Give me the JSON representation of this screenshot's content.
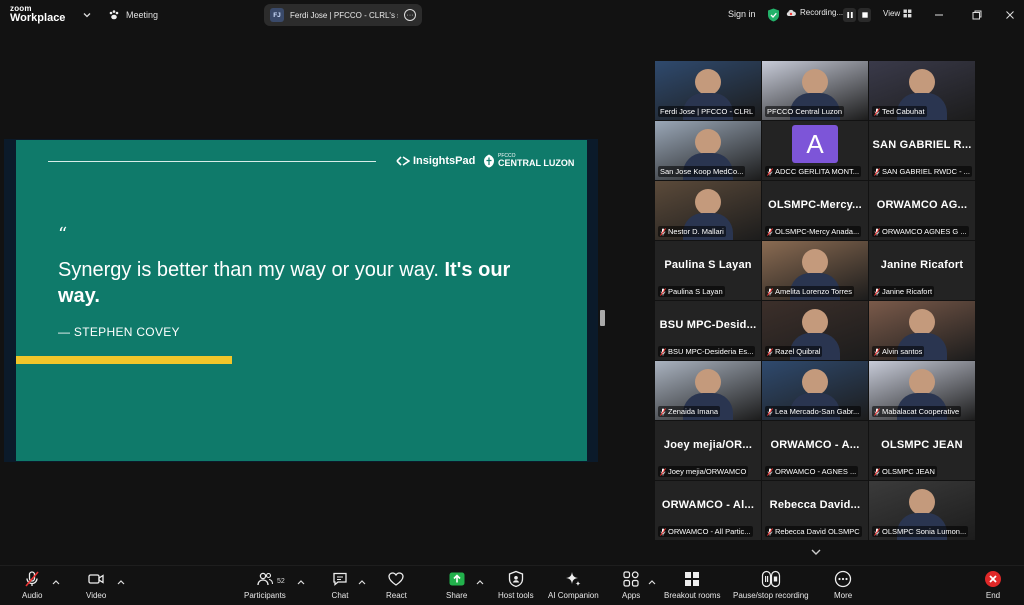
{
  "app": {
    "logo_top": "zoom",
    "logo_bottom": "Workplace"
  },
  "topbar": {
    "meeting_label": "Meeting",
    "share_initials": "FJ",
    "share_title": "Ferdi Jose | PFCCO - CLRL's scree",
    "sign_in": "Sign in",
    "recording_label": "Recording...",
    "view_label": "View"
  },
  "slide": {
    "brand_insights": "InsightsPad",
    "brand_pfcco_small": "PFCCO",
    "brand_pfcco_big": "CENTRAL LUZON",
    "quote_mark": "“",
    "quote_line1": "Synergy is better than my way or your way.",
    "quote_bold": "It's our way.",
    "author": "— STEPHEN COVEY",
    "colors": {
      "background": "#0f7a6a",
      "accent_bar": "#f2c62a"
    }
  },
  "gallery": {
    "tiles": [
      {
        "caption": "Ferdi Jose | PFCCO - CLRL",
        "muted": false,
        "kind": "video",
        "active": true
      },
      {
        "caption": "PFCCO Central Luzon",
        "muted": false,
        "kind": "video"
      },
      {
        "caption": "Ted Cabuhat",
        "muted": true,
        "kind": "video"
      },
      {
        "caption": "San Jose Koop MedCo...",
        "muted": false,
        "kind": "video"
      },
      {
        "caption": "ADCC GERLITA MONT...",
        "muted": true,
        "kind": "avatar",
        "avatar_letter": "A"
      },
      {
        "name": "SAN GABRIEL R...",
        "caption": "SAN GABRIEL RWDC - ...",
        "muted": true,
        "kind": "name"
      },
      {
        "caption": "Nestor D. Mallari",
        "muted": true,
        "kind": "video"
      },
      {
        "name": "OLSMPC-Mercy...",
        "caption": "OLSMPC-Mercy Anada...",
        "muted": true,
        "kind": "name"
      },
      {
        "name": "ORWAMCO AG...",
        "caption": "ORWAMCO AGNES G ...",
        "muted": true,
        "kind": "name"
      },
      {
        "name": "Paulina S Layan",
        "caption": "Paulina S Layan",
        "muted": true,
        "kind": "name"
      },
      {
        "caption": "Amelita Lorenzo Torres",
        "muted": true,
        "kind": "video"
      },
      {
        "name": "Janine Ricafort",
        "caption": "Janine Ricafort",
        "muted": true,
        "kind": "name"
      },
      {
        "name": "BSU MPC-Desid...",
        "caption": "BSU MPC-Desideria Es...",
        "muted": true,
        "kind": "name"
      },
      {
        "caption": "Razel Quibral",
        "muted": true,
        "kind": "video"
      },
      {
        "caption": "Alvin santos",
        "muted": true,
        "kind": "video"
      },
      {
        "caption": "Zenaida Imana",
        "muted": true,
        "kind": "video"
      },
      {
        "caption": "Lea Mercado-San Gabr...",
        "muted": true,
        "kind": "video"
      },
      {
        "caption": "Mabalacat Cooperative",
        "muted": true,
        "kind": "video"
      },
      {
        "name": "Joey mejia/OR...",
        "caption": "Joey mejia/ORWAMCO",
        "muted": true,
        "kind": "name"
      },
      {
        "name": "ORWAMCO - A...",
        "caption": "ORWAMCO - AGNES ...",
        "muted": true,
        "kind": "name"
      },
      {
        "name": "OLSMPC JEAN",
        "caption": "OLSMPC JEAN",
        "muted": true,
        "kind": "name"
      },
      {
        "name": "ORWAMCO - Al...",
        "caption": "ORWAMCO - All Partic...",
        "muted": true,
        "kind": "name"
      },
      {
        "name": "Rebecca David...",
        "caption": "Rebecca David OLSMPC",
        "muted": true,
        "kind": "name"
      },
      {
        "caption": "OLSMPC Sonia Lumon...",
        "muted": true,
        "kind": "video"
      }
    ]
  },
  "toolbar": {
    "audio": "Audio",
    "video": "Video",
    "participants": "Participants",
    "participants_count": "52",
    "chat": "Chat",
    "react": "React",
    "share": "Share",
    "host_tools": "Host tools",
    "ai_companion": "AI Companion",
    "apps": "Apps",
    "breakout": "Breakout rooms",
    "pause_recording": "Pause/stop recording",
    "more": "More",
    "end": "End"
  }
}
